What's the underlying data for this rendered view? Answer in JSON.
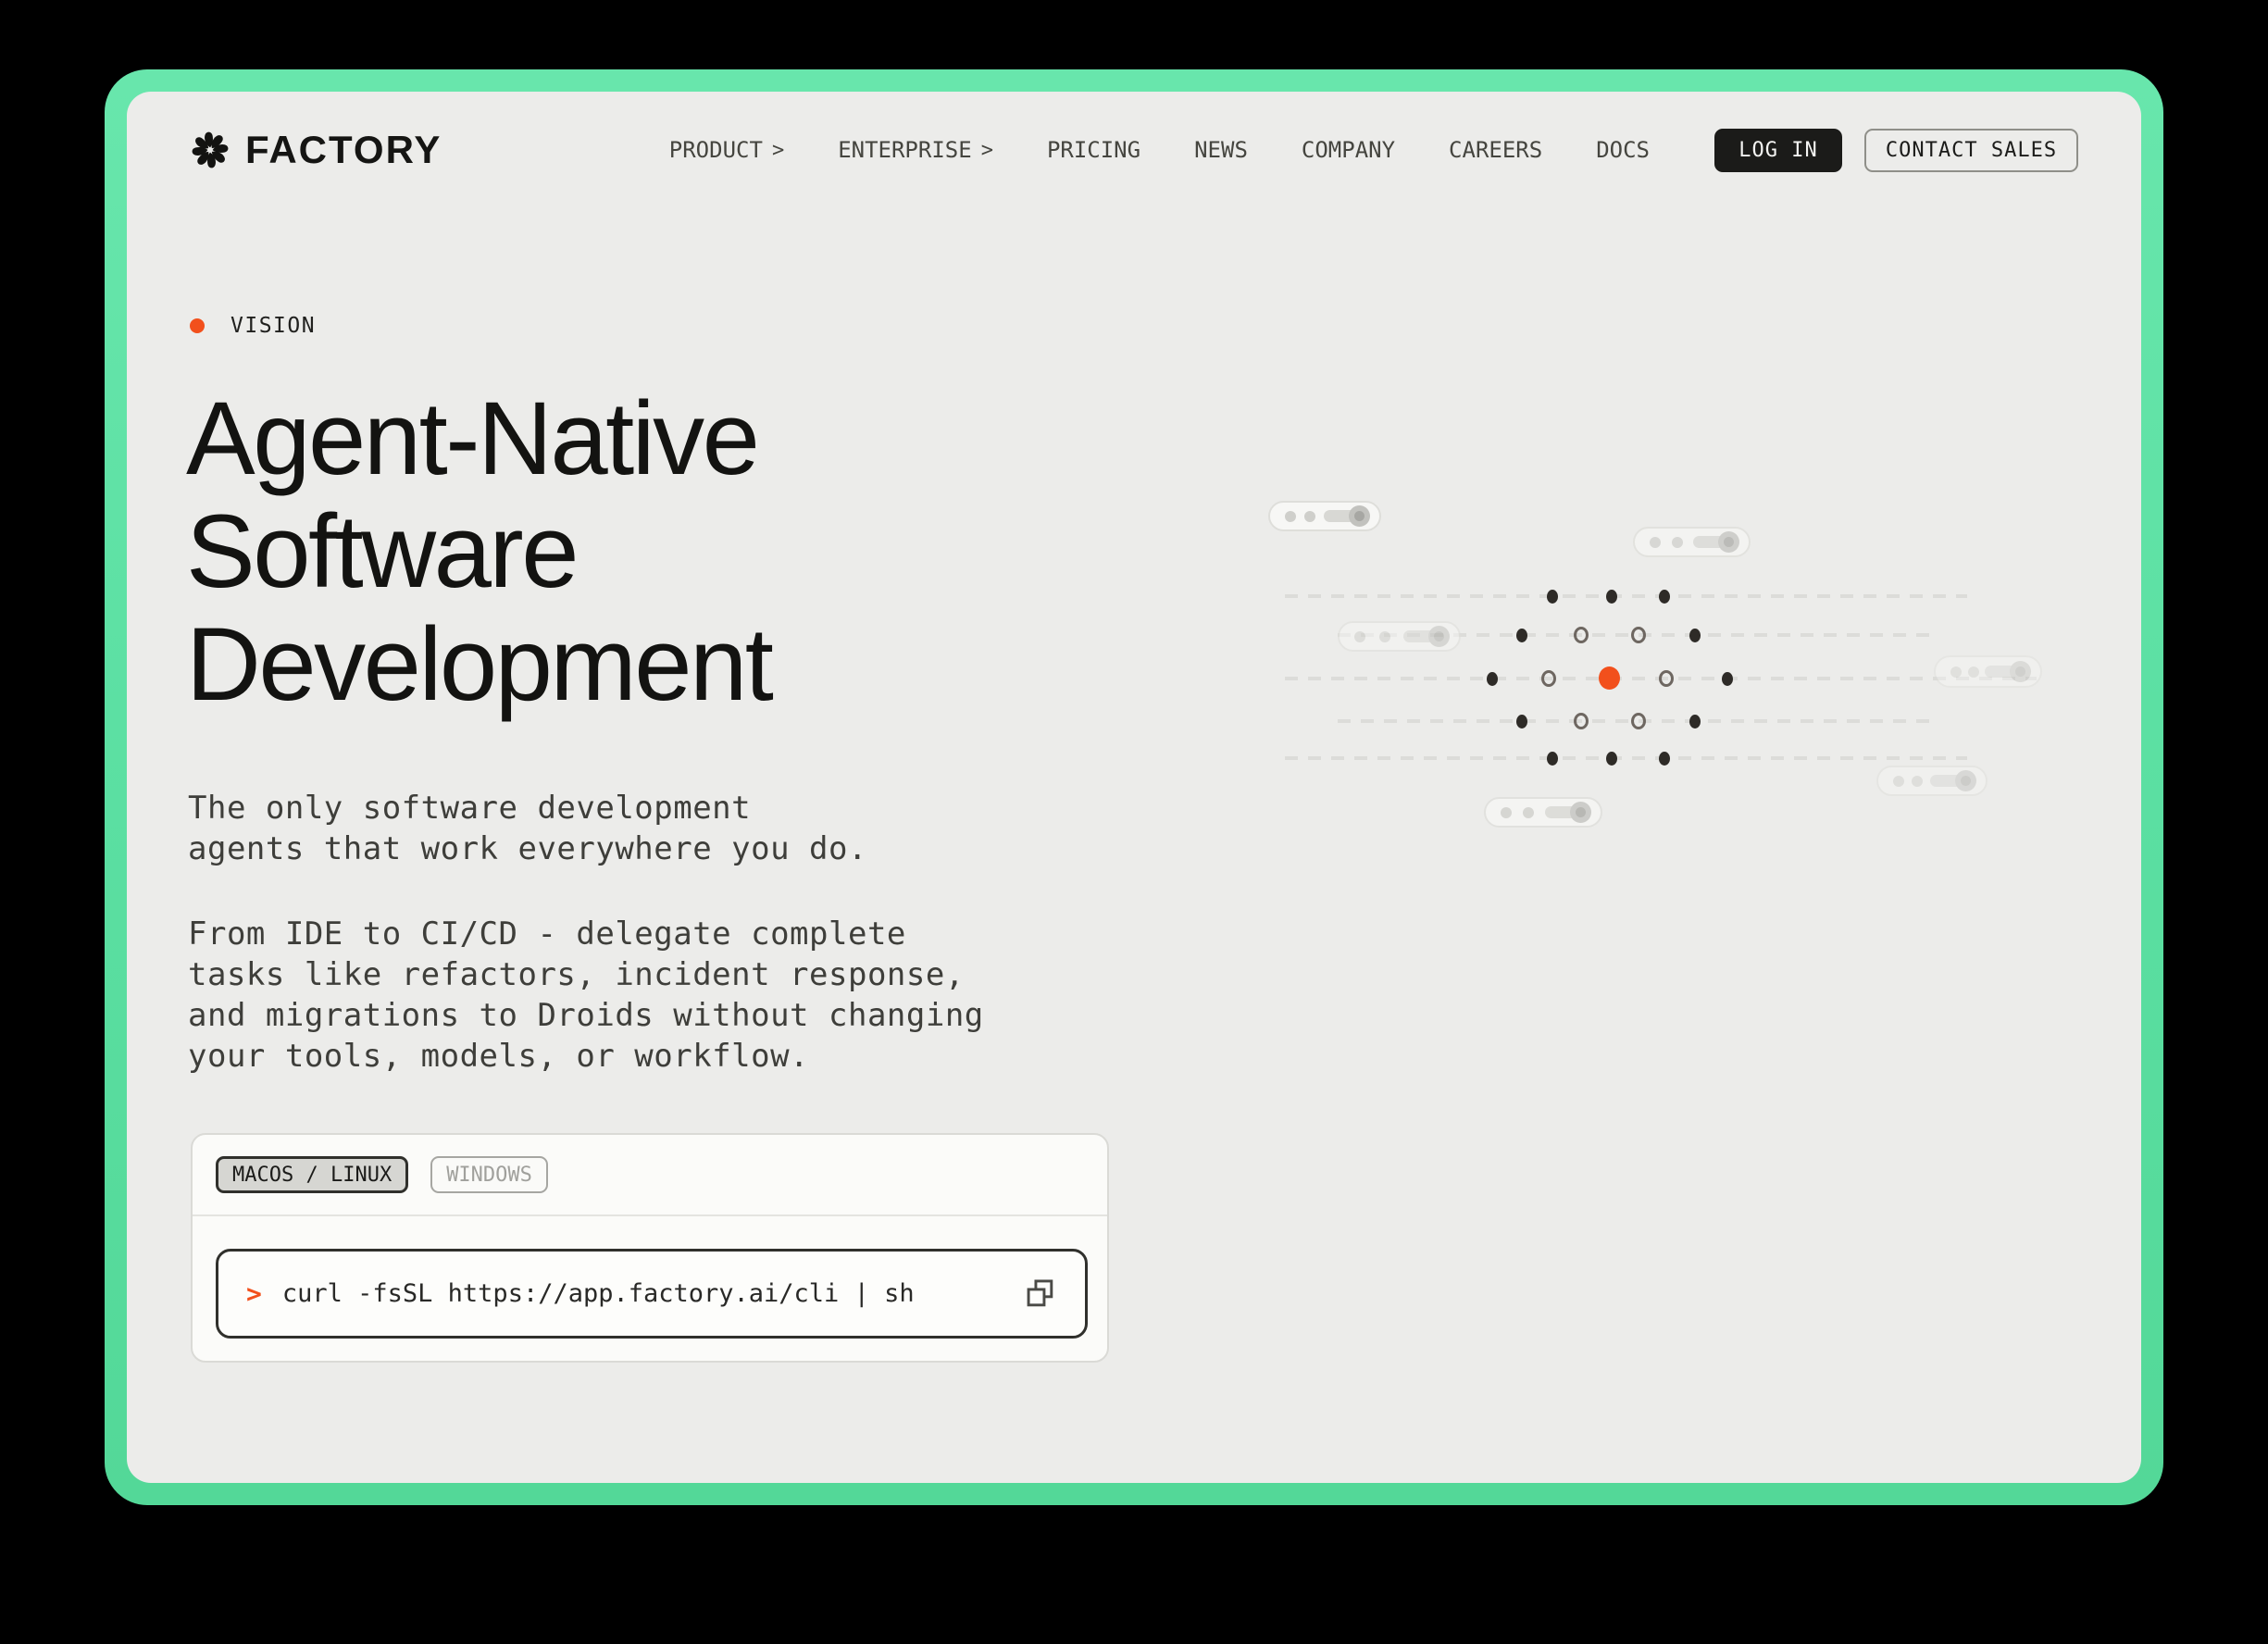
{
  "header": {
    "brand": "FACTORY",
    "nav": [
      {
        "label": "PRODUCT",
        "has_chevron": true
      },
      {
        "label": "ENTERPRISE",
        "has_chevron": true
      },
      {
        "label": "PRICING"
      },
      {
        "label": "NEWS"
      },
      {
        "label": "COMPANY"
      },
      {
        "label": "CAREERS"
      },
      {
        "label": "DOCS"
      }
    ],
    "chevron_glyph": ">",
    "login_label": "LOG IN",
    "contact_label": "CONTACT SALES"
  },
  "hero": {
    "eyebrow": "VISION",
    "title_lines": [
      "Agent-Native",
      "Software",
      "Development"
    ],
    "paragraph1_lines": [
      "The only software development",
      "agents that work everywhere you do."
    ],
    "paragraph2_lines": [
      "From IDE to CI/CD - delegate complete",
      "tasks like refactors, incident response,",
      "and migrations to Droids without changing",
      "your tools, models, or workflow."
    ]
  },
  "install": {
    "tabs": [
      {
        "label": "MACOS / LINUX",
        "active": true
      },
      {
        "label": "WINDOWS",
        "active": false
      }
    ],
    "prompt": ">",
    "command": "curl -fsSL https://app.factory.ai/cli | sh"
  },
  "icons": {
    "logo": "pinwheel-icon",
    "nav_chevron": "chevron-right-icon",
    "copy": "copy-icon",
    "eyebrow_dot": "orange-dot-icon"
  },
  "colors": {
    "frame_green": "#5CE0A3",
    "page_bg": "#ECECEA",
    "ink": "#131311",
    "body_text": "#3E3E3A",
    "accent_orange": "#F2501C",
    "login_bg": "#1B1B19"
  }
}
